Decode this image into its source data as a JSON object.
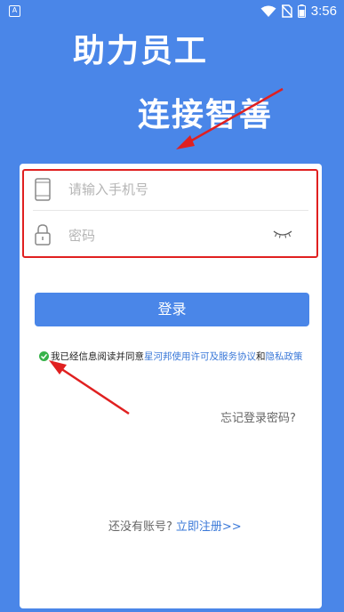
{
  "status_bar": {
    "time": "3:56",
    "left_icon": "A",
    "icons": [
      "wifi-icon",
      "no-sim-icon",
      "battery-icon"
    ]
  },
  "hero": {
    "line1": "助力员工",
    "line2": "连接智善"
  },
  "login_form": {
    "phone_placeholder": "请输入手机号",
    "password_placeholder": "密码",
    "login_button": "登录"
  },
  "agreement": {
    "prefix": "我已经信息阅读并同意",
    "link1": "星河邦使用许可及服务协议",
    "conjunction": "和",
    "link2": "隐私政策"
  },
  "forgot_password": "忘记登录密码?",
  "register": {
    "prompt": "还没有账号?",
    "link": "立即注册>>"
  },
  "colors": {
    "background": "#4a86e8",
    "accent": "#4a86e8",
    "annotation": "#e02020",
    "check": "#36b24a"
  }
}
